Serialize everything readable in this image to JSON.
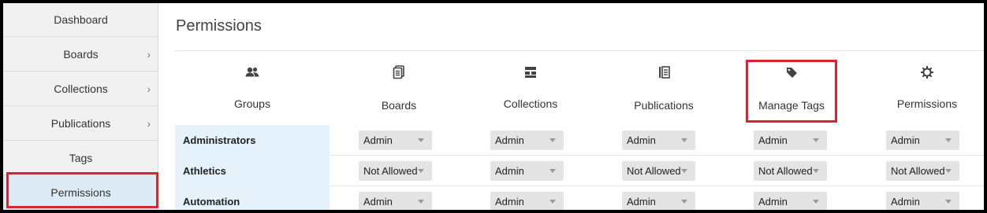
{
  "sidebar": {
    "items": [
      {
        "label": "Dashboard",
        "chevron": false
      },
      {
        "label": "Boards",
        "chevron": true
      },
      {
        "label": "Collections",
        "chevron": true
      },
      {
        "label": "Publications",
        "chevron": true
      },
      {
        "label": "Tags",
        "chevron": false
      },
      {
        "label": "Permissions",
        "chevron": false,
        "active": true
      }
    ],
    "chevron_glyph": "›"
  },
  "main": {
    "title": "Permissions",
    "columns": [
      {
        "label": "Groups",
        "icon": "users-icon"
      },
      {
        "label": "Boards",
        "icon": "boards-icon"
      },
      {
        "label": "Collections",
        "icon": "collections-icon"
      },
      {
        "label": "Publications",
        "icon": "publications-icon"
      },
      {
        "label": "Manage Tags",
        "icon": "tag-icon"
      },
      {
        "label": "Permissions",
        "icon": "gear-icon"
      }
    ],
    "rows": [
      {
        "group": "Administrators",
        "values": [
          "Admin",
          "Admin",
          "Admin",
          "Admin",
          "Admin"
        ]
      },
      {
        "group": "Athletics",
        "values": [
          "Not Allowed",
          "Admin",
          "Not Allowed",
          "Not Allowed",
          "Not Allowed"
        ]
      },
      {
        "group": "Automation",
        "values": [
          "Admin",
          "Admin",
          "Admin",
          "Admin",
          "Admin"
        ]
      }
    ]
  },
  "colors": {
    "highlight": "#d7262e",
    "active_bg": "#dcebf5",
    "group_bg": "#e6f2fb"
  }
}
